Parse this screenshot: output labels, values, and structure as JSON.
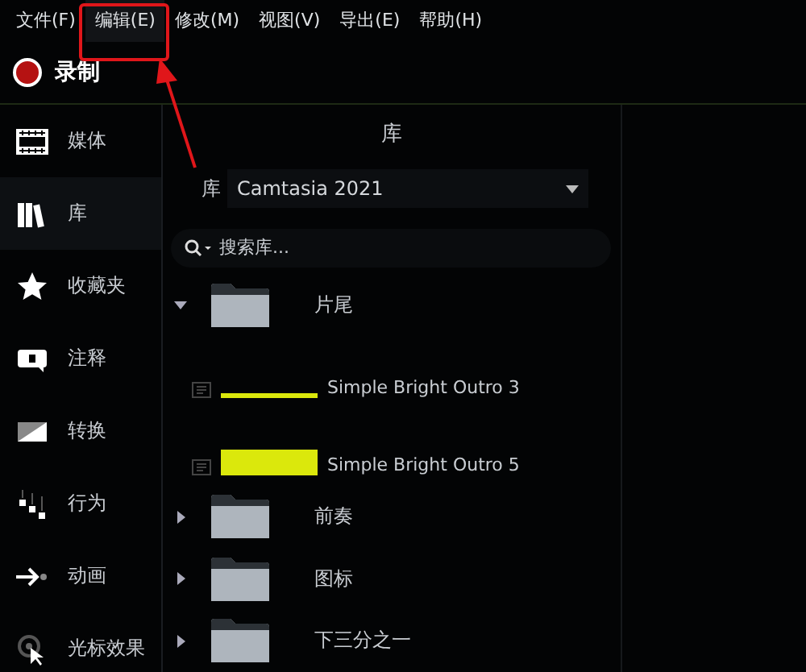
{
  "menu": [
    {
      "label": "文件(F)",
      "highlighted": false
    },
    {
      "label": "编辑(E)",
      "highlighted": true
    },
    {
      "label": "修改(M)",
      "highlighted": false
    },
    {
      "label": "视图(V)",
      "highlighted": false
    },
    {
      "label": "导出(E)",
      "highlighted": false
    },
    {
      "label": "帮助(H)",
      "highlighted": false
    }
  ],
  "record": {
    "label": "录制"
  },
  "sidebar": {
    "items": [
      {
        "kind": "media",
        "label": "媒体",
        "selected": false
      },
      {
        "kind": "library",
        "label": "库",
        "selected": true
      },
      {
        "kind": "favorites",
        "label": "收藏夹",
        "selected": false
      },
      {
        "kind": "annotations",
        "label": "注释",
        "selected": false
      },
      {
        "kind": "transitions",
        "label": "转换",
        "selected": false
      },
      {
        "kind": "behaviors",
        "label": "行为",
        "selected": false
      },
      {
        "kind": "animations",
        "label": "动画",
        "selected": false
      },
      {
        "kind": "cursor",
        "label": "光标效果",
        "selected": false
      }
    ]
  },
  "library": {
    "title": "库",
    "select_label": "库",
    "select_value": "Camtasia 2021",
    "search": {
      "placeholder": "搜索库..."
    },
    "tree": [
      {
        "kind": "folder",
        "label": "片尾",
        "expanded": true,
        "children": [
          {
            "kind": "asset",
            "label": "Simple Bright Outro 3",
            "thumb": {
              "kind": "strip"
            }
          },
          {
            "kind": "asset",
            "label": "Simple Bright Outro 5",
            "thumb": {
              "kind": "block"
            }
          }
        ]
      },
      {
        "kind": "folder",
        "label": "前奏",
        "expanded": false
      },
      {
        "kind": "folder",
        "label": "图标",
        "expanded": false
      },
      {
        "kind": "folder",
        "label": "下三分之一",
        "expanded": false
      }
    ]
  }
}
